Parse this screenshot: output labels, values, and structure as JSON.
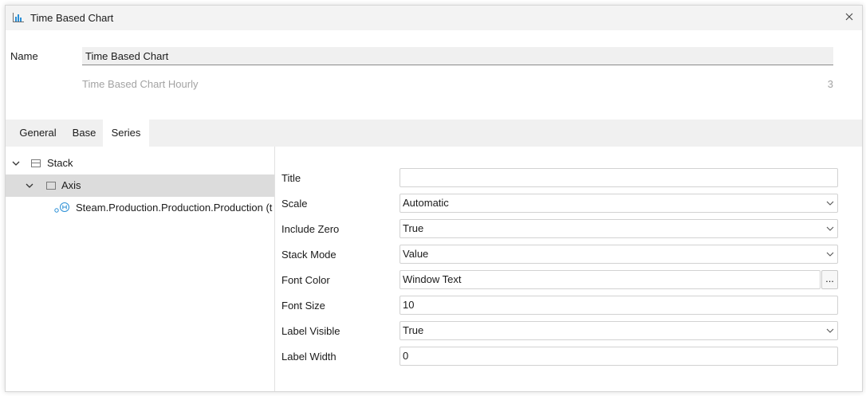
{
  "window": {
    "title": "Time Based Chart",
    "icon": "bar-chart-icon"
  },
  "header": {
    "name_label": "Name",
    "name_value": "Time Based Chart",
    "subtitle": "Time Based Chart Hourly",
    "count": "3"
  },
  "tabs": [
    {
      "label": "General",
      "active": false
    },
    {
      "label": "Base",
      "active": false
    },
    {
      "label": "Series",
      "active": true
    }
  ],
  "tree": {
    "items": [
      {
        "label": "Stack",
        "level": 0,
        "expanded": true,
        "selected": false,
        "icon": "stack-icon"
      },
      {
        "label": "Axis",
        "level": 1,
        "expanded": true,
        "selected": true,
        "icon": "axis-icon"
      },
      {
        "label": "Steam.Production.Production.Production (t",
        "level": 2,
        "selected": false,
        "icon": "historian-tag-icon"
      }
    ]
  },
  "properties": [
    {
      "label": "Title",
      "value": "",
      "type": "text"
    },
    {
      "label": "Scale",
      "value": "Automatic",
      "type": "select"
    },
    {
      "label": "Include Zero",
      "value": "True",
      "type": "select"
    },
    {
      "label": "Stack Mode",
      "value": "Value",
      "type": "select"
    },
    {
      "label": "Font Color",
      "value": "Window Text",
      "type": "picker",
      "button_label": "..."
    },
    {
      "label": "Font Size",
      "value": "10",
      "type": "text"
    },
    {
      "label": "Label Visible",
      "value": "True",
      "type": "select"
    },
    {
      "label": "Label Width",
      "value": "0",
      "type": "text"
    }
  ],
  "colors": {
    "accent": "#2a8fd6",
    "titlebar_bg": "#f3f3f3",
    "tabbar_bg": "#f0f0f0",
    "selected_row": "#dcdcdc"
  }
}
